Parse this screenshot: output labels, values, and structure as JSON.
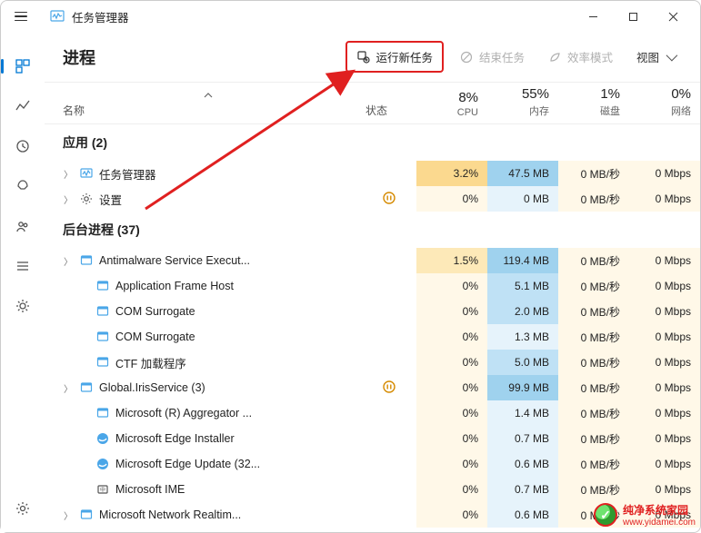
{
  "window": {
    "title": "任务管理器"
  },
  "toolbar": {
    "page_title": "进程",
    "run_new_task": "运行新任务",
    "end_task": "结束任务",
    "efficiency_mode": "效率模式",
    "view": "视图"
  },
  "columns": {
    "name": "名称",
    "status": "状态",
    "cpu_pct": "8%",
    "cpu_lbl": "CPU",
    "mem_pct": "55%",
    "mem_lbl": "内存",
    "disk_pct": "1%",
    "disk_lbl": "磁盘",
    "net_pct": "0%",
    "net_lbl": "网络"
  },
  "groups": {
    "apps": "应用 (2)",
    "bg": "后台进程 (37)"
  },
  "rows": [
    {
      "grp": "apps",
      "expand": true,
      "icon": "monitor",
      "name": "任务管理器",
      "status": "",
      "cpu": "3.2%",
      "cpu_bg": "bg-hi-cpu",
      "mem": "47.5 MB",
      "mem_bg": "bg-hi-mem",
      "disk": "0 MB/秒",
      "net": "0 Mbps"
    },
    {
      "grp": "apps",
      "expand": true,
      "icon": "gear",
      "name": "设置",
      "status": "pause",
      "cpu": "0%",
      "cpu_bg": "bg-low",
      "mem": "0 MB",
      "mem_bg": "bg-low-mem",
      "disk": "0 MB/秒",
      "net": "0 Mbps"
    },
    {
      "grp": "bg",
      "expand": true,
      "icon": "window",
      "name": "Antimalware Service Execut...",
      "status": "",
      "cpu": "1.5%",
      "cpu_bg": "bg-med-cpu",
      "mem": "119.4 MB",
      "mem_bg": "bg-hi-mem",
      "disk": "0 MB/秒",
      "net": "0 Mbps"
    },
    {
      "grp": "bg",
      "expand": false,
      "icon": "window",
      "name": "Application Frame Host",
      "status": "",
      "cpu": "0%",
      "cpu_bg": "bg-low",
      "mem": "5.1 MB",
      "mem_bg": "bg-med-mem",
      "disk": "0 MB/秒",
      "net": "0 Mbps"
    },
    {
      "grp": "bg",
      "expand": false,
      "icon": "window",
      "name": "COM Surrogate",
      "status": "",
      "cpu": "0%",
      "cpu_bg": "bg-low",
      "mem": "2.0 MB",
      "mem_bg": "bg-med-mem",
      "disk": "0 MB/秒",
      "net": "0 Mbps"
    },
    {
      "grp": "bg",
      "expand": false,
      "icon": "window",
      "name": "COM Surrogate",
      "status": "",
      "cpu": "0%",
      "cpu_bg": "bg-low",
      "mem": "1.3 MB",
      "mem_bg": "bg-low-mem",
      "disk": "0 MB/秒",
      "net": "0 Mbps"
    },
    {
      "grp": "bg",
      "expand": false,
      "icon": "window",
      "name": "CTF 加载程序",
      "status": "",
      "cpu": "0%",
      "cpu_bg": "bg-low",
      "mem": "5.0 MB",
      "mem_bg": "bg-med-mem",
      "disk": "0 MB/秒",
      "net": "0 Mbps"
    },
    {
      "grp": "bg",
      "expand": true,
      "icon": "window",
      "name": "Global.IrisService (3)",
      "status": "pause",
      "cpu": "0%",
      "cpu_bg": "bg-low",
      "mem": "99.9 MB",
      "mem_bg": "bg-hi-mem",
      "disk": "0 MB/秒",
      "net": "0 Mbps"
    },
    {
      "grp": "bg",
      "expand": false,
      "icon": "window",
      "name": "Microsoft (R) Aggregator ...",
      "status": "",
      "cpu": "0%",
      "cpu_bg": "bg-low",
      "mem": "1.4 MB",
      "mem_bg": "bg-low-mem",
      "disk": "0 MB/秒",
      "net": "0 Mbps"
    },
    {
      "grp": "bg",
      "expand": false,
      "icon": "edge",
      "name": "Microsoft Edge Installer",
      "status": "",
      "cpu": "0%",
      "cpu_bg": "bg-low",
      "mem": "0.7 MB",
      "mem_bg": "bg-low-mem",
      "disk": "0 MB/秒",
      "net": "0 Mbps"
    },
    {
      "grp": "bg",
      "expand": false,
      "icon": "edge",
      "name": "Microsoft Edge Update (32...",
      "status": "",
      "cpu": "0%",
      "cpu_bg": "bg-low",
      "mem": "0.6 MB",
      "mem_bg": "bg-low-mem",
      "disk": "0 MB/秒",
      "net": "0 Mbps"
    },
    {
      "grp": "bg",
      "expand": false,
      "icon": "ime",
      "name": "Microsoft IME",
      "status": "",
      "cpu": "0%",
      "cpu_bg": "bg-low",
      "mem": "0.7 MB",
      "mem_bg": "bg-low-mem",
      "disk": "0 MB/秒",
      "net": "0 Mbps"
    },
    {
      "grp": "bg",
      "expand": true,
      "icon": "window",
      "name": "Microsoft Network Realtim...",
      "status": "",
      "cpu": "0%",
      "cpu_bg": "bg-low",
      "mem": "0.6 MB",
      "mem_bg": "bg-low-mem",
      "disk": "0 MB/秒",
      "net": "0 Mbps"
    }
  ],
  "watermark": {
    "brand": "纯净系统家园",
    "url": "www.yidamei.com"
  }
}
